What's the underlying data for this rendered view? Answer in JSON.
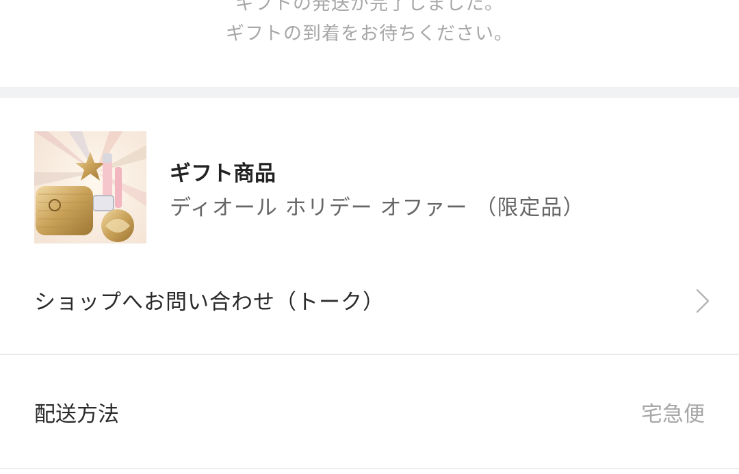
{
  "notice": {
    "line1": "ギフトの発送が完了しました。",
    "line2": "ギフトの到着をお待ちください。"
  },
  "product": {
    "title": "ギフト商品",
    "name": "ディオール ホリデー オファー （限定品）",
    "image_icon": "gift-product-image"
  },
  "contact": {
    "label": "ショップへお問い合わせ（トーク）",
    "icon": "chevron-right-icon"
  },
  "shipping": {
    "label": "配送方法",
    "value": "宅急便"
  },
  "colors": {
    "separator": "#f1f2f4",
    "muted_text": "#a7a7a7",
    "primary_text": "#222222"
  }
}
